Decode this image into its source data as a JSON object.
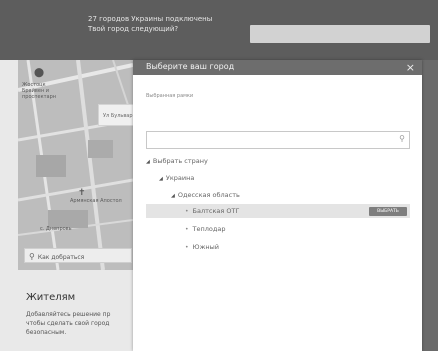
{
  "topbar": {
    "message_line1": "27 городов Украины подключены",
    "message_line2": "Твой город следующий?"
  },
  "map": {
    "label_top": "Жостоцк\nБрайвен и\nпроспектарн",
    "callout_text": "Ул Бульвар",
    "label_mid": "Армянская Апостол",
    "label_bottom": "с. Днепровь",
    "route_button": "Как добраться"
  },
  "left_panel": {
    "heading": "Жителям",
    "text": "Добавляйтесь решение пр\nчтобы сделать свой город\nбезопасным."
  },
  "modal": {
    "title": "Выберите ваш город",
    "close_glyph": "×",
    "selected_label": "Выбранная рамки",
    "search_value": "",
    "search_placeholder": "",
    "tree": {
      "root": "Выбрать страну",
      "country": "Украина",
      "region": "Одесская область",
      "cities": [
        "Балтская ОТГ",
        "Теплодар",
        "Южный"
      ]
    },
    "choose_button": "ВЫБРАТЬ"
  },
  "colors": {
    "topbar": "#5d5d5d",
    "modal_header": "#6d6d6d",
    "selected_row": "#e4e4e4",
    "button": "#7e7e7e"
  },
  "icons": [
    "close-icon",
    "search-icon",
    "expand-arrow-icon",
    "bullet-icon",
    "map-pin-icon"
  ]
}
